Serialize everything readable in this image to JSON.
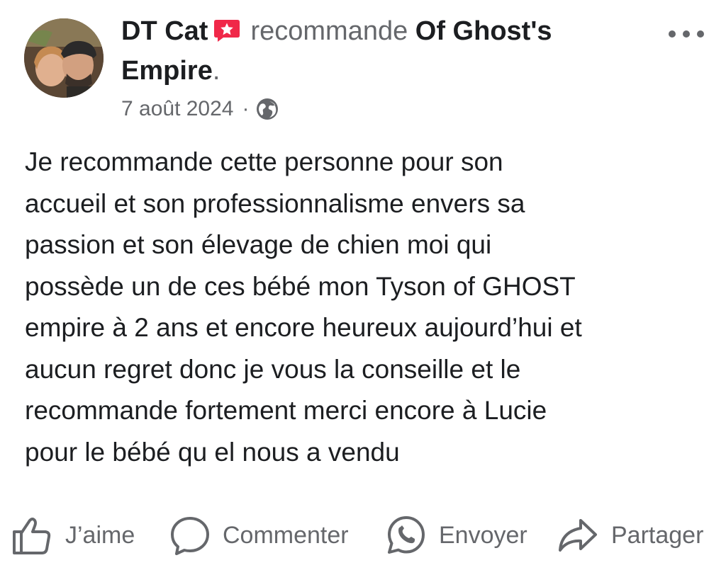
{
  "post": {
    "author": "DT Cat",
    "verb": "recommande",
    "page": "Of Ghost's Empire",
    "period": ".",
    "date": "7 août 2024",
    "separator": "·",
    "audience_icon": "globe-icon",
    "badge_icon": "recommendation-star-icon",
    "badge_color": "#f02849",
    "body": "Je recommande cette personne pour son\naccueil et son professionnalisme envers sa\npassion et son élevage de chien moi qui\npossède un de ces bébé mon Tyson of GHOST\nempire à 2 ans et encore heureux aujourd’hui et\naucun regret donc je vous la conseille et le\nrecommande fortement merci encore à Lucie\npour le bébé qu el nous a vendu"
  },
  "actions": {
    "like": "J’aime",
    "comment": "Commenter",
    "send": "Envoyer",
    "share": "Partager"
  },
  "colors": {
    "text_primary": "#1c1e21",
    "text_secondary": "#65676b",
    "background": "#ffffff"
  }
}
